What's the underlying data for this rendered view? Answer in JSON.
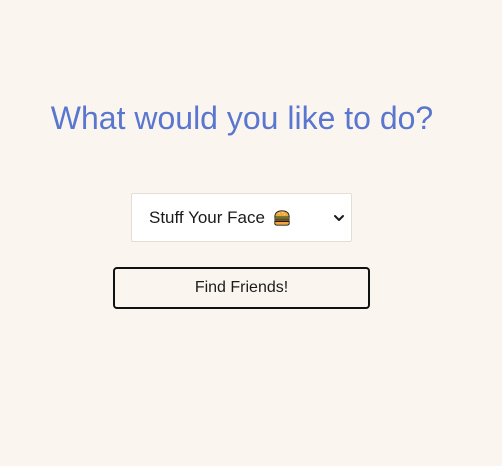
{
  "page": {
    "heading": "What would you like to do?",
    "background_color": "#faf6ef",
    "heading_color": "#5a76cf"
  },
  "activity_select": {
    "selected_value": "Stuff Your Face",
    "selected_icon": "burger-icon",
    "dropdown_icon": "chevron-down-icon"
  },
  "find_button": {
    "label": "Find Friends!"
  }
}
